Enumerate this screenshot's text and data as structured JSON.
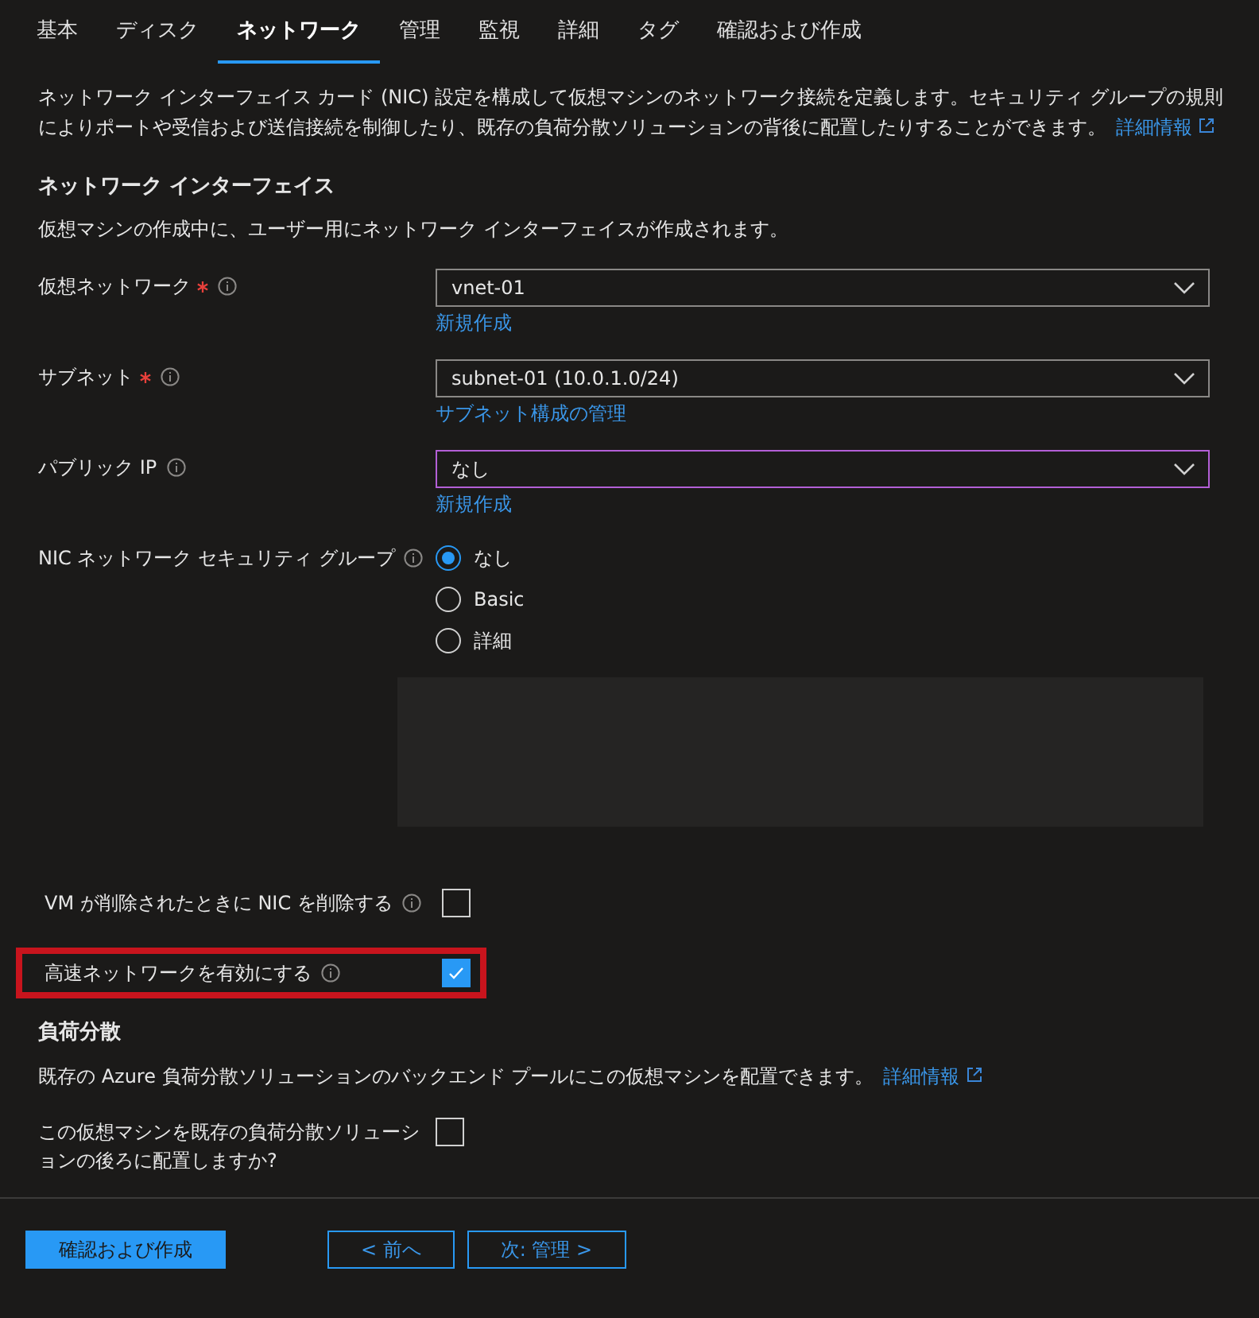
{
  "tabs": [
    {
      "label": "基本",
      "selected": false
    },
    {
      "label": "ディスク",
      "selected": false
    },
    {
      "label": "ネットワーク",
      "selected": true
    },
    {
      "label": "管理",
      "selected": false
    },
    {
      "label": "監視",
      "selected": false
    },
    {
      "label": "詳細",
      "selected": false
    },
    {
      "label": "タグ",
      "selected": false
    },
    {
      "label": "確認および作成",
      "selected": false
    }
  ],
  "intro": {
    "text": "ネットワーク インターフェイス カード (NIC) 設定を構成して仮想マシンのネットワーク接続を定義します。セキュリティ グループの規則によりポートや受信および送信接続を制御したり、既存の負荷分散ソリューションの背後に配置したりすることができます。",
    "link": "詳細情報"
  },
  "network_interface": {
    "heading": "ネットワーク インターフェイス",
    "description": "仮想マシンの作成中に、ユーザー用にネットワーク インターフェイスが作成されます。",
    "fields": [
      {
        "kind": "dropdown",
        "label": "仮想ネットワーク",
        "required": true,
        "value": "vnet-01",
        "focused": false,
        "link": "新規作成"
      },
      {
        "kind": "dropdown",
        "label": "サブネット",
        "required": true,
        "value": "subnet-01 (10.0.1.0/24)",
        "focused": false,
        "link": "サブネット構成の管理"
      },
      {
        "kind": "dropdown",
        "label": "パブリック IP",
        "required": false,
        "value": "なし",
        "focused": true,
        "link": "新規作成"
      },
      {
        "kind": "radio",
        "label": "NIC ネットワーク セキュリティ グループ",
        "required": false,
        "options": [
          {
            "label": "なし",
            "selected": true
          },
          {
            "label": "Basic",
            "selected": false
          },
          {
            "label": "詳細",
            "selected": false
          }
        ]
      },
      {
        "kind": "checkbox",
        "label": "VM が削除されたときに NIC を削除する",
        "checked": false,
        "highlighted": false
      },
      {
        "kind": "checkbox",
        "label": "高速ネットワークを有効にする",
        "checked": true,
        "highlighted": true
      }
    ]
  },
  "load_balancing": {
    "heading": "負荷分散",
    "description": "既存の Azure 負荷分散ソリューションのバックエンド プールにこの仮想マシンを配置できます。",
    "link": "詳細情報",
    "question": "この仮想マシンを既存の負荷分散ソリューションの後ろに配置しますか?",
    "checked": false
  },
  "buttons": [
    {
      "label": "確認および作成",
      "kind": "primary"
    },
    {
      "label": "< 前へ",
      "kind": "secondary"
    },
    {
      "label": "次: 管理 >",
      "kind": "secondary"
    }
  ]
}
